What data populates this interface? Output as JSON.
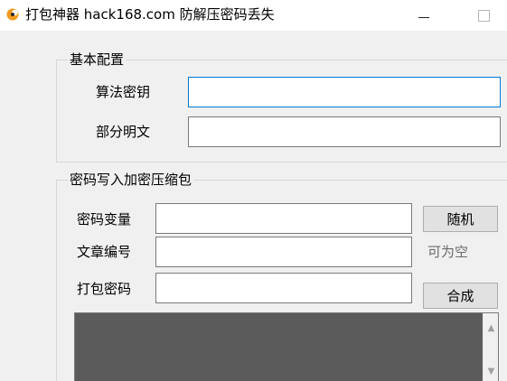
{
  "window": {
    "title": "打包神器 hack168.com 防解压密码丢失"
  },
  "basic_config": {
    "title": "基本配置",
    "algorithm_key": {
      "label": "算法密钥",
      "value": ""
    },
    "partial_plaintext": {
      "label": "部分明文",
      "value": ""
    }
  },
  "archive_section": {
    "title": "密码写入加密压缩包",
    "password_variable": {
      "label": "密码变量",
      "value": ""
    },
    "article_number": {
      "label": "文章编号",
      "value": "",
      "hint": "可为空"
    },
    "pack_password": {
      "label": "打包密码",
      "value": ""
    },
    "random_button": "随机",
    "compose_button": "合成",
    "output_text": ""
  },
  "colors": {
    "accent": "#0078d7",
    "app_icon": "#f29a1e",
    "output_bg": "#5b5b5b"
  },
  "icons": {
    "app": "app-logo-icon",
    "minimize": "minimize-icon",
    "maximize": "maximize-icon",
    "scroll_up": "chevron-up-icon",
    "scroll_down": "chevron-down-icon"
  }
}
